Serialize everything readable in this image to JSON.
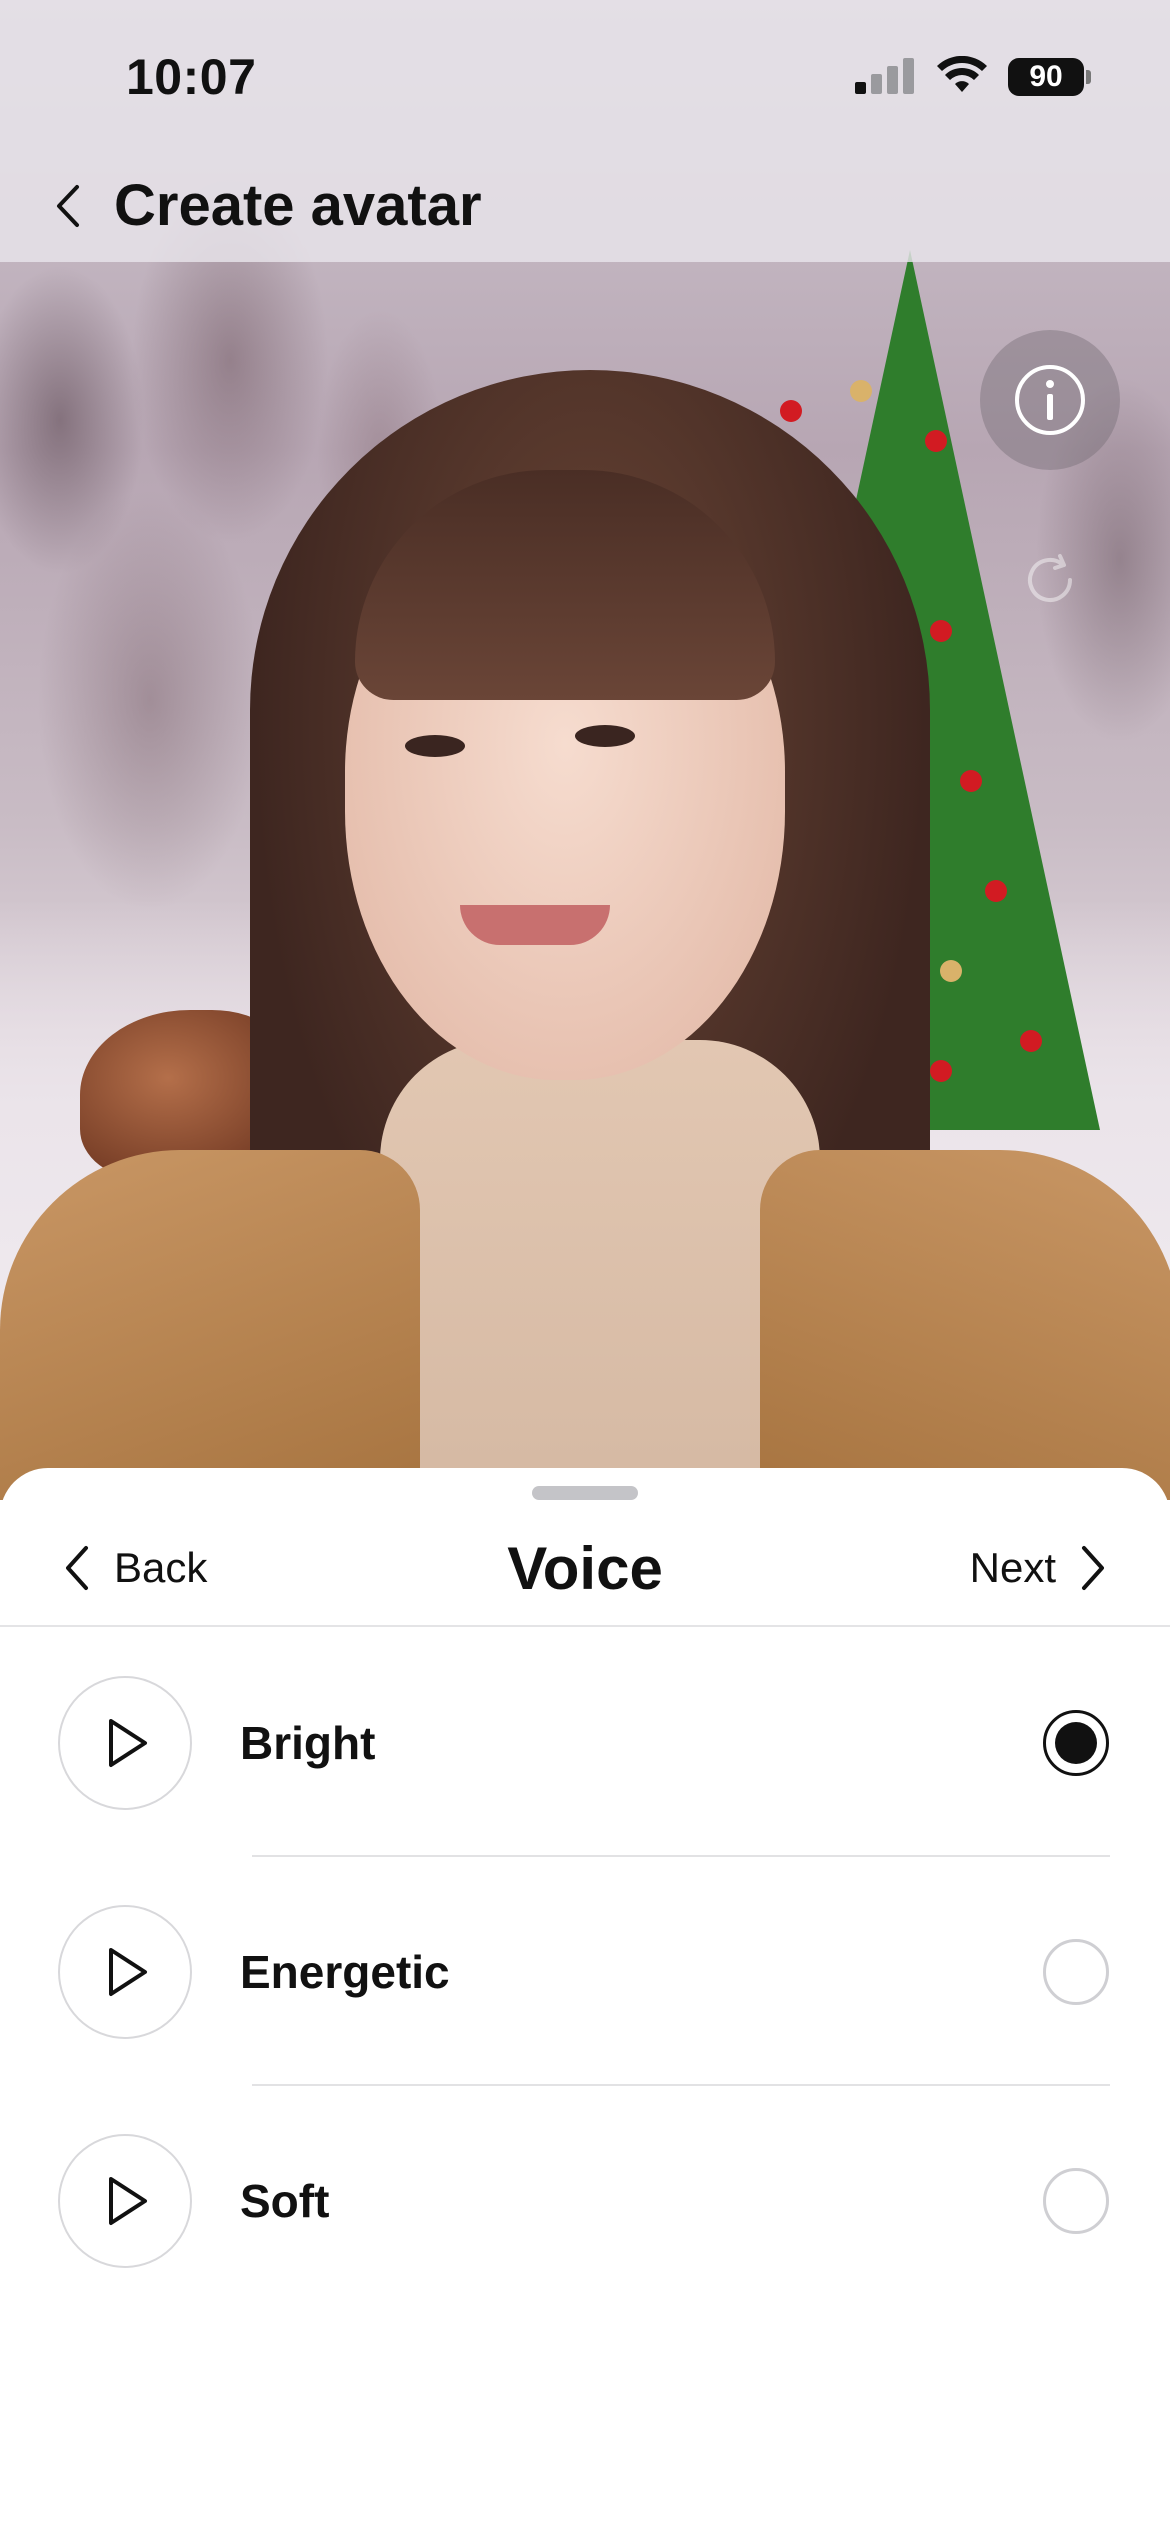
{
  "status_bar": {
    "time": "10:07",
    "battery_level": "90",
    "icons": [
      "cellular-signal-icon",
      "wifi-icon",
      "battery-icon"
    ]
  },
  "nav": {
    "title": "Create avatar",
    "back_icon": "chevron-left-icon"
  },
  "preview": {
    "info_icon": "info-icon",
    "refresh_icon": "refresh-icon"
  },
  "sheet": {
    "back_label": "Back",
    "title": "Voice",
    "next_label": "Next",
    "voices": [
      {
        "label": "Bright",
        "selected": true
      },
      {
        "label": "Energetic",
        "selected": false
      },
      {
        "label": "Soft",
        "selected": false
      }
    ]
  },
  "colors": {
    "accent": "#111111",
    "radio_unselected_border": "#cfcfd3",
    "divider": "#e2e2e4"
  }
}
